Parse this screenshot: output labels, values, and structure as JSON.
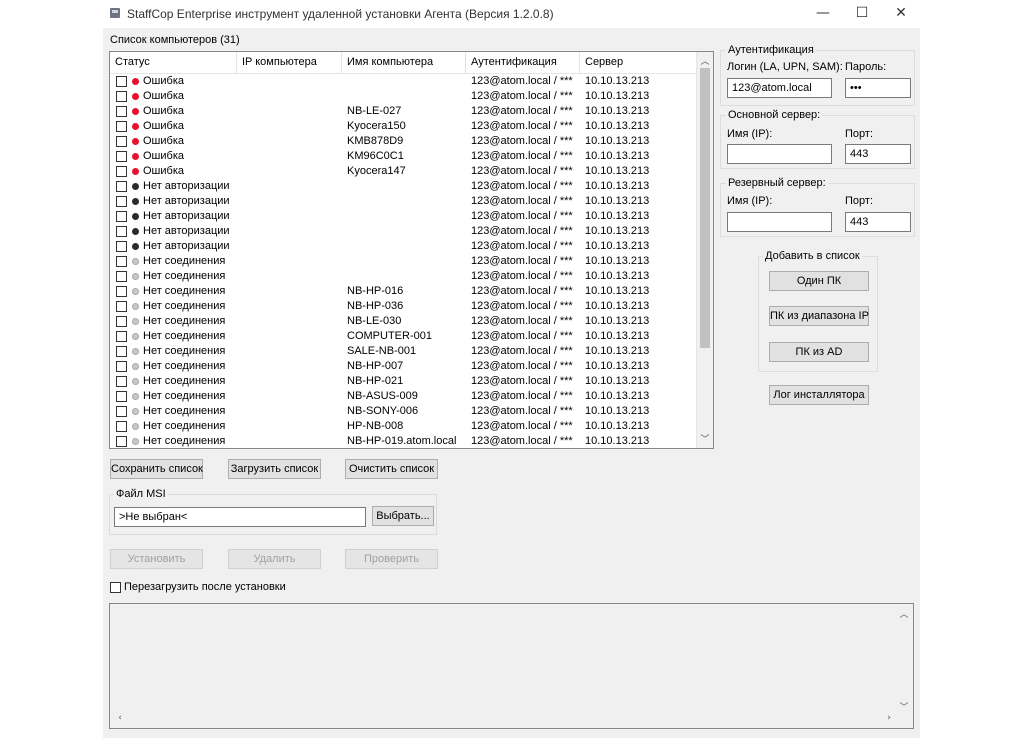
{
  "window": {
    "title": "StaffCop Enterprise инструмент удаленной установки Агента (Версия 1.2.0.8)",
    "minimize": "—",
    "maximize": "☐",
    "close": "✕"
  },
  "list": {
    "title": "Список компьютеров (31)",
    "columns": [
      "Статус",
      "IP компьютера",
      "Имя компьютера",
      "Аутентификация",
      "Сервер"
    ],
    "rows": [
      {
        "status": "Ошибка",
        "kind": "error",
        "ip": "",
        "name": "",
        "auth": "123@atom.local / ***",
        "server": "10.10.13.213"
      },
      {
        "status": "Ошибка",
        "kind": "error",
        "ip": "",
        "name": "",
        "auth": "123@atom.local / ***",
        "server": "10.10.13.213"
      },
      {
        "status": "Ошибка",
        "kind": "error",
        "ip": "",
        "name": "NB-LE-027",
        "auth": "123@atom.local / ***",
        "server": "10.10.13.213"
      },
      {
        "status": "Ошибка",
        "kind": "error",
        "ip": "",
        "name": "Kyocera150",
        "auth": "123@atom.local / ***",
        "server": "10.10.13.213"
      },
      {
        "status": "Ошибка",
        "kind": "error",
        "ip": "",
        "name": "KMB878D9",
        "auth": "123@atom.local / ***",
        "server": "10.10.13.213"
      },
      {
        "status": "Ошибка",
        "kind": "error",
        "ip": "",
        "name": "KM96C0C1",
        "auth": "123@atom.local / ***",
        "server": "10.10.13.213"
      },
      {
        "status": "Ошибка",
        "kind": "error",
        "ip": "",
        "name": "Kyocera147",
        "auth": "123@atom.local / ***",
        "server": "10.10.13.213"
      },
      {
        "status": "Нет авторизации",
        "kind": "noauth",
        "ip": "",
        "name": "",
        "auth": "123@atom.local / ***",
        "server": "10.10.13.213"
      },
      {
        "status": "Нет авторизации",
        "kind": "noauth",
        "ip": "",
        "name": "",
        "auth": "123@atom.local / ***",
        "server": "10.10.13.213"
      },
      {
        "status": "Нет авторизации",
        "kind": "noauth",
        "ip": "",
        "name": "",
        "auth": "123@atom.local / ***",
        "server": "10.10.13.213"
      },
      {
        "status": "Нет авторизации",
        "kind": "noauth",
        "ip": "",
        "name": "",
        "auth": "123@atom.local / ***",
        "server": "10.10.13.213"
      },
      {
        "status": "Нет авторизации",
        "kind": "noauth",
        "ip": "",
        "name": "",
        "auth": "123@atom.local / ***",
        "server": "10.10.13.213"
      },
      {
        "status": "Нет соединения",
        "kind": "noconn",
        "ip": "",
        "name": "",
        "auth": "123@atom.local / ***",
        "server": "10.10.13.213"
      },
      {
        "status": "Нет соединения",
        "kind": "noconn",
        "ip": "",
        "name": "",
        "auth": "123@atom.local / ***",
        "server": "10.10.13.213"
      },
      {
        "status": "Нет соединения",
        "kind": "noconn",
        "ip": "",
        "name": "NB-HP-016",
        "auth": "123@atom.local / ***",
        "server": "10.10.13.213"
      },
      {
        "status": "Нет соединения",
        "kind": "noconn",
        "ip": "",
        "name": "NB-HP-036",
        "auth": "123@atom.local / ***",
        "server": "10.10.13.213"
      },
      {
        "status": "Нет соединения",
        "kind": "noconn",
        "ip": "",
        "name": "NB-LE-030",
        "auth": "123@atom.local / ***",
        "server": "10.10.13.213"
      },
      {
        "status": "Нет соединения",
        "kind": "noconn",
        "ip": "",
        "name": "COMPUTER-001",
        "auth": "123@atom.local / ***",
        "server": "10.10.13.213"
      },
      {
        "status": "Нет соединения",
        "kind": "noconn",
        "ip": "",
        "name": "SALE-NB-001",
        "auth": "123@atom.local / ***",
        "server": "10.10.13.213"
      },
      {
        "status": "Нет соединения",
        "kind": "noconn",
        "ip": "",
        "name": "NB-HP-007",
        "auth": "123@atom.local / ***",
        "server": "10.10.13.213"
      },
      {
        "status": "Нет соединения",
        "kind": "noconn",
        "ip": "",
        "name": "NB-HP-021",
        "auth": "123@atom.local / ***",
        "server": "10.10.13.213"
      },
      {
        "status": "Нет соединения",
        "kind": "noconn",
        "ip": "",
        "name": "NB-ASUS-009",
        "auth": "123@atom.local / ***",
        "server": "10.10.13.213"
      },
      {
        "status": "Нет соединения",
        "kind": "noconn",
        "ip": "",
        "name": "NB-SONY-006",
        "auth": "123@atom.local / ***",
        "server": "10.10.13.213"
      },
      {
        "status": "Нет соединения",
        "kind": "noconn",
        "ip": "",
        "name": "HP-NB-008",
        "auth": "123@atom.local / ***",
        "server": "10.10.13.213"
      },
      {
        "status": "Нет соединения",
        "kind": "noconn",
        "ip": "",
        "name": "NB-HP-019.atom.local",
        "auth": "123@atom.local / ***",
        "server": "10.10.13.213"
      }
    ]
  },
  "status_colors": {
    "error": "#e8112d",
    "noauth": "#2b2b2b",
    "noconn": "#c8c8c8"
  },
  "buttons": {
    "save_list": "Сохранить список",
    "load_list": "Загрузить список",
    "clear_list": "Очистить список",
    "install": "Установить",
    "remove": "Удалить",
    "check": "Проверить"
  },
  "msi": {
    "group_title": "Файл MSI",
    "value": ">Не выбран<",
    "browse": "Выбрать..."
  },
  "reboot": {
    "label": "Перезагрузить после установки"
  },
  "auth": {
    "group_title": "Аутентификация",
    "login_label": "Логин (LA, UPN, SAM):",
    "login_value": "123@atom.local",
    "password_label": "Пароль:",
    "password_value": "•••"
  },
  "main_server": {
    "group_title": "Основной сервер:",
    "name_label": "Имя (IP):",
    "name_value": "",
    "port_label": "Порт:",
    "port_value": "443"
  },
  "backup_server": {
    "group_title": "Резервный сервер:",
    "name_label": "Имя (IP):",
    "name_value": "",
    "port_label": "Порт:",
    "port_value": "443"
  },
  "add": {
    "group_title": "Добавить в список",
    "one_pc": "Один ПК",
    "range": "ПК из диапазона IP",
    "ad": "ПК из AD"
  },
  "installer_log": "Лог инсталлятора"
}
